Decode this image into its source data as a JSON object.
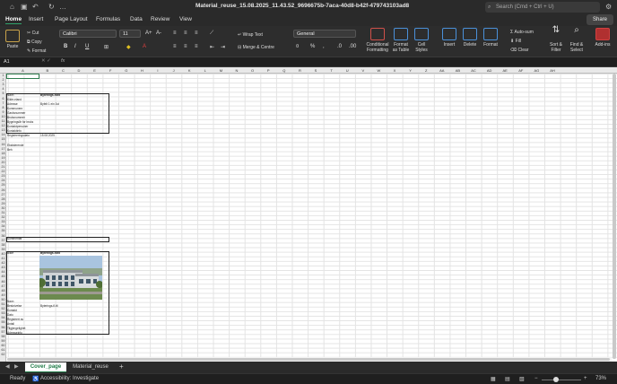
{
  "window": {
    "title": "Material_reuse_15.08.2025_11.43.52_9696675b-7aca-40d8-b42f-479743103ad8",
    "search_placeholder": "Search (Cmd + Ctrl + U)"
  },
  "tabs": [
    "Home",
    "Insert",
    "Page Layout",
    "Formulas",
    "Data",
    "Review",
    "View"
  ],
  "share_label": "Share",
  "ribbon": {
    "paste": "Paste",
    "cut": "Cut",
    "copy": "Copy",
    "format": "Format",
    "font": "Calibri",
    "font_size": "11",
    "wrap_text": "Wrap Text",
    "merge_centre": "Merge & Centre",
    "number_format": "General",
    "conditional_formatting": "Conditional Formatting",
    "format_as_table": "Format as Table",
    "cell_styles": "Cell Styles",
    "insert": "Insert",
    "delete": "Delete",
    "format_cells": "Format",
    "auto_sum": "Auto-sum",
    "fill": "Fill",
    "clear": "Clear",
    "sort_filter": "Sort & Filter",
    "find_select": "Find & Select",
    "add_ins": "Add-ins"
  },
  "formula_bar": {
    "cell_ref": "A1",
    "fx": "fx"
  },
  "columns": [
    "A",
    "B",
    "C",
    "D",
    "E",
    "F",
    "G",
    "H",
    "I",
    "J",
    "K",
    "L",
    "M",
    "N",
    "O",
    "P",
    "Q",
    "R",
    "S",
    "T",
    "U",
    "V",
    "W",
    "X",
    "Y",
    "Z",
    "AA",
    "AB",
    "AC",
    "AD",
    "AE",
    "AF",
    "AG",
    "AH"
  ],
  "cells": {
    "b1_label": "Navn",
    "b1_value": "Byterings-flott",
    "b2": "Kilde-eland",
    "b3": "Adresse",
    "b3_value": "Byfelt 1 ein 1st",
    "b4": "Kommunenr",
    "b5": "Gardsnummer",
    "b6": "Bruksnummer",
    "b7": "Bygningsår for bruks",
    "b8": "Kontaktpersoner",
    "b9": "Kontaktinfo",
    "b10": "Registreringsdato",
    "b10_value": "15.08.2025",
    "section_title": "Eksisterende",
    "sub": "Beh",
    "footer_label": "Kommentar",
    "b11_label": "Bilde",
    "b11_value": "Byterings-flott",
    "r1": "Navn",
    "r2": "Beskrivelse",
    "r2_value": "Byterings-fl-ttl",
    "r3": "Kontakt",
    "r4": "Dato",
    "r5": "Registrert av",
    "r6": "Antall",
    "r7": "Tilgjengelighet",
    "r8": "Adresseinfo"
  },
  "sheet_tabs": [
    "Cover_page",
    "Material_reuse"
  ],
  "status": {
    "ready": "Ready",
    "accessibility": "Accessibility: Investigate",
    "zoom": "73%"
  }
}
